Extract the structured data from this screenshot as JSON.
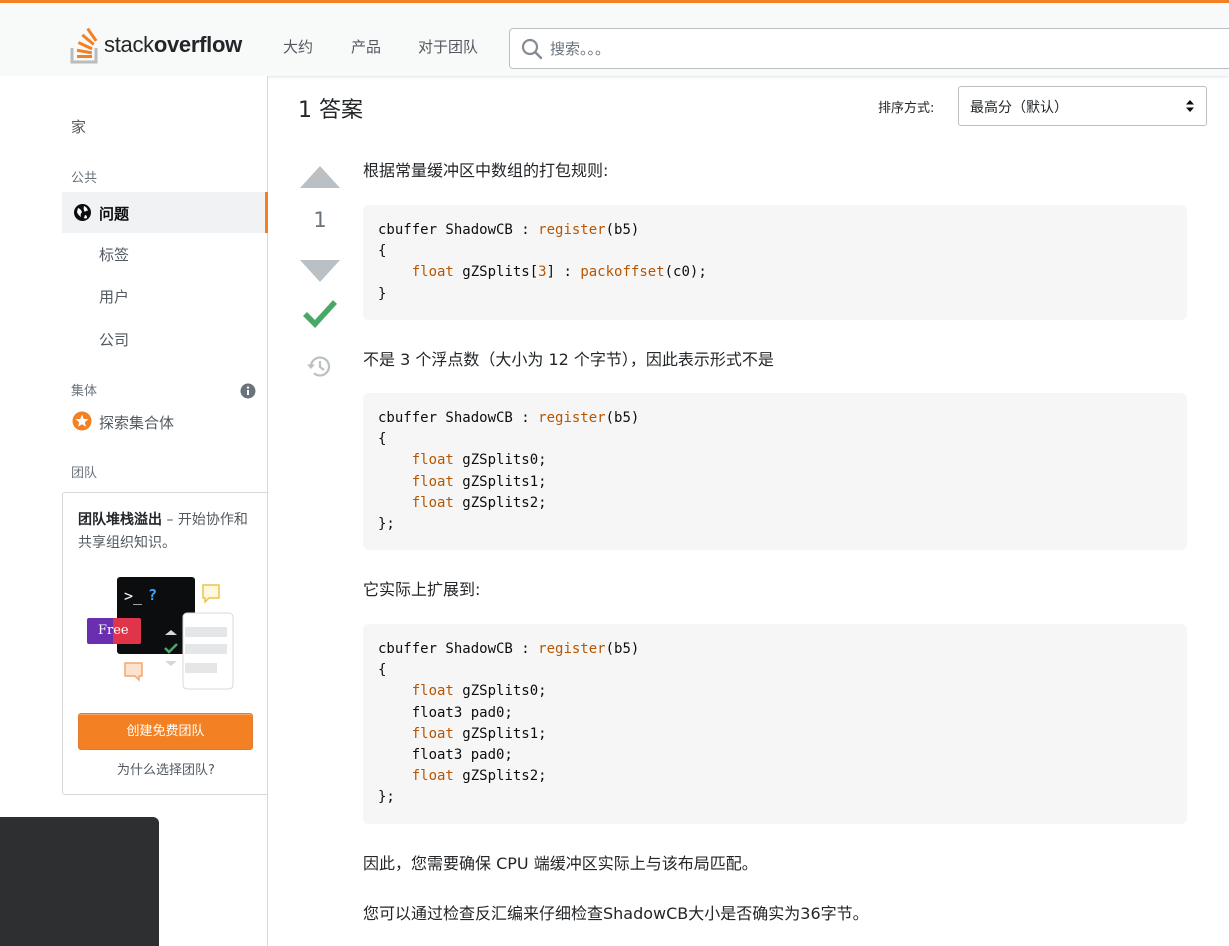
{
  "header": {
    "logo_prefix": "stack",
    "logo_suffix": "overflow",
    "nav": [
      "大约",
      "产品",
      "对于团队"
    ],
    "search_placeholder": "搜索。。。"
  },
  "sidebar": {
    "home": "家",
    "public_heading": "公共",
    "questions": "问题",
    "tags": "标签",
    "users": "用户",
    "companies": "公司",
    "collectives_heading": "集体",
    "explore_collectives": "探索集合体",
    "teams_heading": "团队",
    "teams_promo_bold": "团队堆栈溢出",
    "teams_promo_rest": " – 开始协作和共享组织知识。",
    "teams_badge": "Free",
    "teams_button": "创建免费团队",
    "teams_why": "为什么选择团队?"
  },
  "answers": {
    "count_label": "1 答案",
    "sort_label": "排序方式:",
    "sort_value": "最高分（默认）"
  },
  "answer": {
    "votes": "1",
    "p1": "根据常量缓冲区中数组的打包规则:",
    "code1": [
      [
        [
          "t",
          "cbuffer ShadowCB : "
        ],
        [
          "k",
          "register"
        ],
        [
          "t",
          "(b5)"
        ]
      ],
      [
        [
          "t",
          "{"
        ]
      ],
      [
        [
          "t",
          "    "
        ],
        [
          "k",
          "float"
        ],
        [
          "t",
          " gZSplits["
        ],
        [
          "k",
          "3"
        ],
        [
          "t",
          "] : "
        ],
        [
          "k",
          "packoffset"
        ],
        [
          "t",
          "(c0);"
        ]
      ],
      [
        [
          "t",
          "}"
        ]
      ]
    ],
    "p2": "不是 3 个浮点数（大小为 12 个字节），因此表示形式不是",
    "code2": [
      [
        [
          "t",
          "cbuffer ShadowCB : "
        ],
        [
          "k",
          "register"
        ],
        [
          "t",
          "(b5)"
        ]
      ],
      [
        [
          "t",
          "{"
        ]
      ],
      [
        [
          "t",
          "    "
        ],
        [
          "k",
          "float"
        ],
        [
          "t",
          " gZSplits0;"
        ]
      ],
      [
        [
          "t",
          "    "
        ],
        [
          "k",
          "float"
        ],
        [
          "t",
          " gZSplits1;"
        ]
      ],
      [
        [
          "t",
          "    "
        ],
        [
          "k",
          "float"
        ],
        [
          "t",
          " gZSplits2;"
        ]
      ],
      [
        [
          "t",
          "};"
        ]
      ]
    ],
    "p3": "它实际上扩展到:",
    "code3": [
      [
        [
          "t",
          "cbuffer ShadowCB : "
        ],
        [
          "k",
          "register"
        ],
        [
          "t",
          "(b5)"
        ]
      ],
      [
        [
          "t",
          "{"
        ]
      ],
      [
        [
          "t",
          "    "
        ],
        [
          "k",
          "float"
        ],
        [
          "t",
          " gZSplits0;"
        ]
      ],
      [
        [
          "t",
          "    float3 pad0;"
        ]
      ],
      [
        [
          "t",
          "    "
        ],
        [
          "k",
          "float"
        ],
        [
          "t",
          " gZSplits1;"
        ]
      ],
      [
        [
          "t",
          "    float3 pad0;"
        ]
      ],
      [
        [
          "t",
          "    "
        ],
        [
          "k",
          "float"
        ],
        [
          "t",
          " gZSplits2;"
        ]
      ],
      [
        [
          "t",
          "};"
        ]
      ]
    ],
    "p4": "因此，您需要确保 CPU 端缓冲区实际上与该布局匹配。",
    "p5": "您可以通过检查反汇编来仔细检查ShadowCB大小是否确实为36字节。"
  },
  "colors": {
    "accent": "#f48024",
    "accepted": "#48a868",
    "vote_arrow": "#bbc0c4",
    "keyword": "#b75501"
  }
}
